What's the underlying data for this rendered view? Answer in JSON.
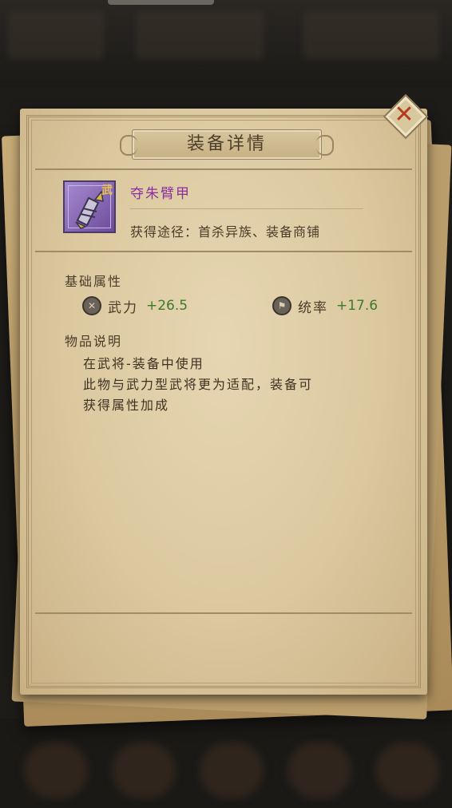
{
  "dialog": {
    "title": "装备详情",
    "close_icon": "close-icon"
  },
  "item": {
    "name": "夺朱臂甲",
    "icon": "armguard-icon",
    "icon_badge": "武",
    "source": "获得途径：首杀异族、装备商铺"
  },
  "base_attributes": {
    "label": "基础属性",
    "stats": [
      {
        "icon": "swords-icon",
        "name": "武力",
        "value": "+26.5"
      },
      {
        "icon": "banner-icon",
        "name": "统率",
        "value": "+17.6"
      }
    ]
  },
  "description": {
    "label": "物品说明",
    "lines": [
      "在武将-装备中使用",
      "此物与武力型武将更为适配，装备可",
      "获得属性加成"
    ]
  },
  "colors": {
    "item_name": "#8c2fa0",
    "stat_value": "#3d7a2c",
    "close_x": "#b53a22"
  }
}
